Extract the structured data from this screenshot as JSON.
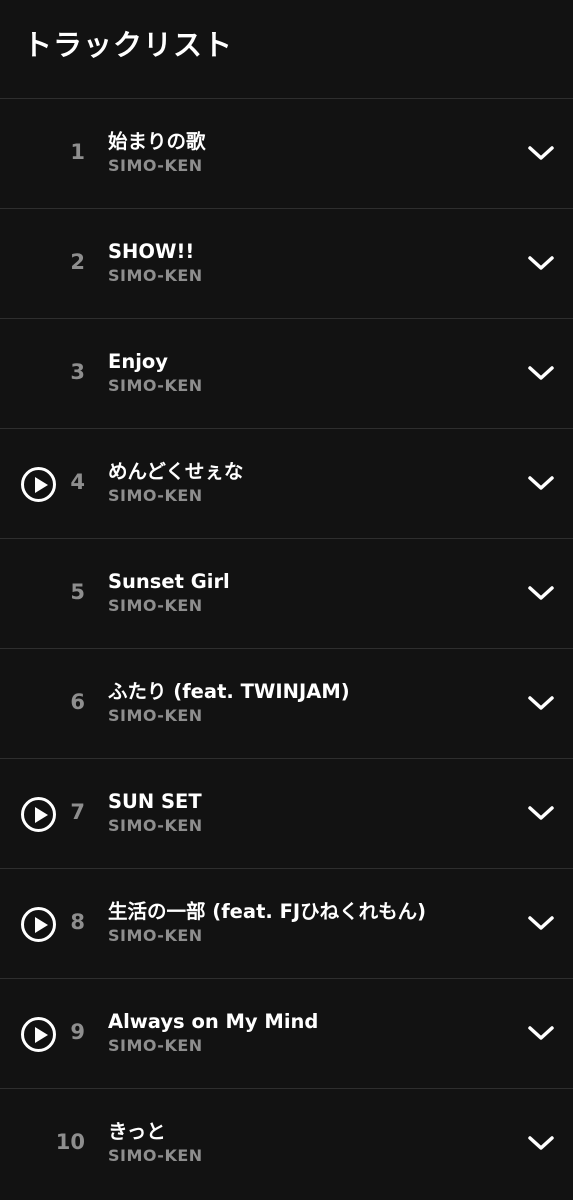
{
  "header": {
    "title": "トラックリスト"
  },
  "tracks": [
    {
      "number": "1",
      "title": "始まりの歌",
      "artist": "SIMO-KEN",
      "has_play": false
    },
    {
      "number": "2",
      "title": "SHOW!!",
      "artist": "SIMO-KEN",
      "has_play": false
    },
    {
      "number": "3",
      "title": "Enjoy",
      "artist": "SIMO-KEN",
      "has_play": false
    },
    {
      "number": "4",
      "title": "めんどくせぇな",
      "artist": "SIMO-KEN",
      "has_play": true
    },
    {
      "number": "5",
      "title": "Sunset Girl",
      "artist": "SIMO-KEN",
      "has_play": false
    },
    {
      "number": "6",
      "title": "ふたり (feat. TWINJAM)",
      "artist": "SIMO-KEN",
      "has_play": false
    },
    {
      "number": "7",
      "title": "SUN SET",
      "artist": "SIMO-KEN",
      "has_play": true
    },
    {
      "number": "8",
      "title": "生活の一部 (feat. FJひねくれもん)",
      "artist": "SIMO-KEN",
      "has_play": true
    },
    {
      "number": "9",
      "title": "Always on My Mind",
      "artist": "SIMO-KEN",
      "has_play": true
    },
    {
      "number": "10",
      "title": "きっと",
      "artist": "SIMO-KEN",
      "has_play": false
    }
  ],
  "icons": {
    "play": "play-circle-icon",
    "expand": "chevron-down-icon"
  },
  "colors": {
    "background": "#121212",
    "divider": "#2e2e2e",
    "primary_text": "#ffffff",
    "secondary_text": "#8e8e8e"
  }
}
